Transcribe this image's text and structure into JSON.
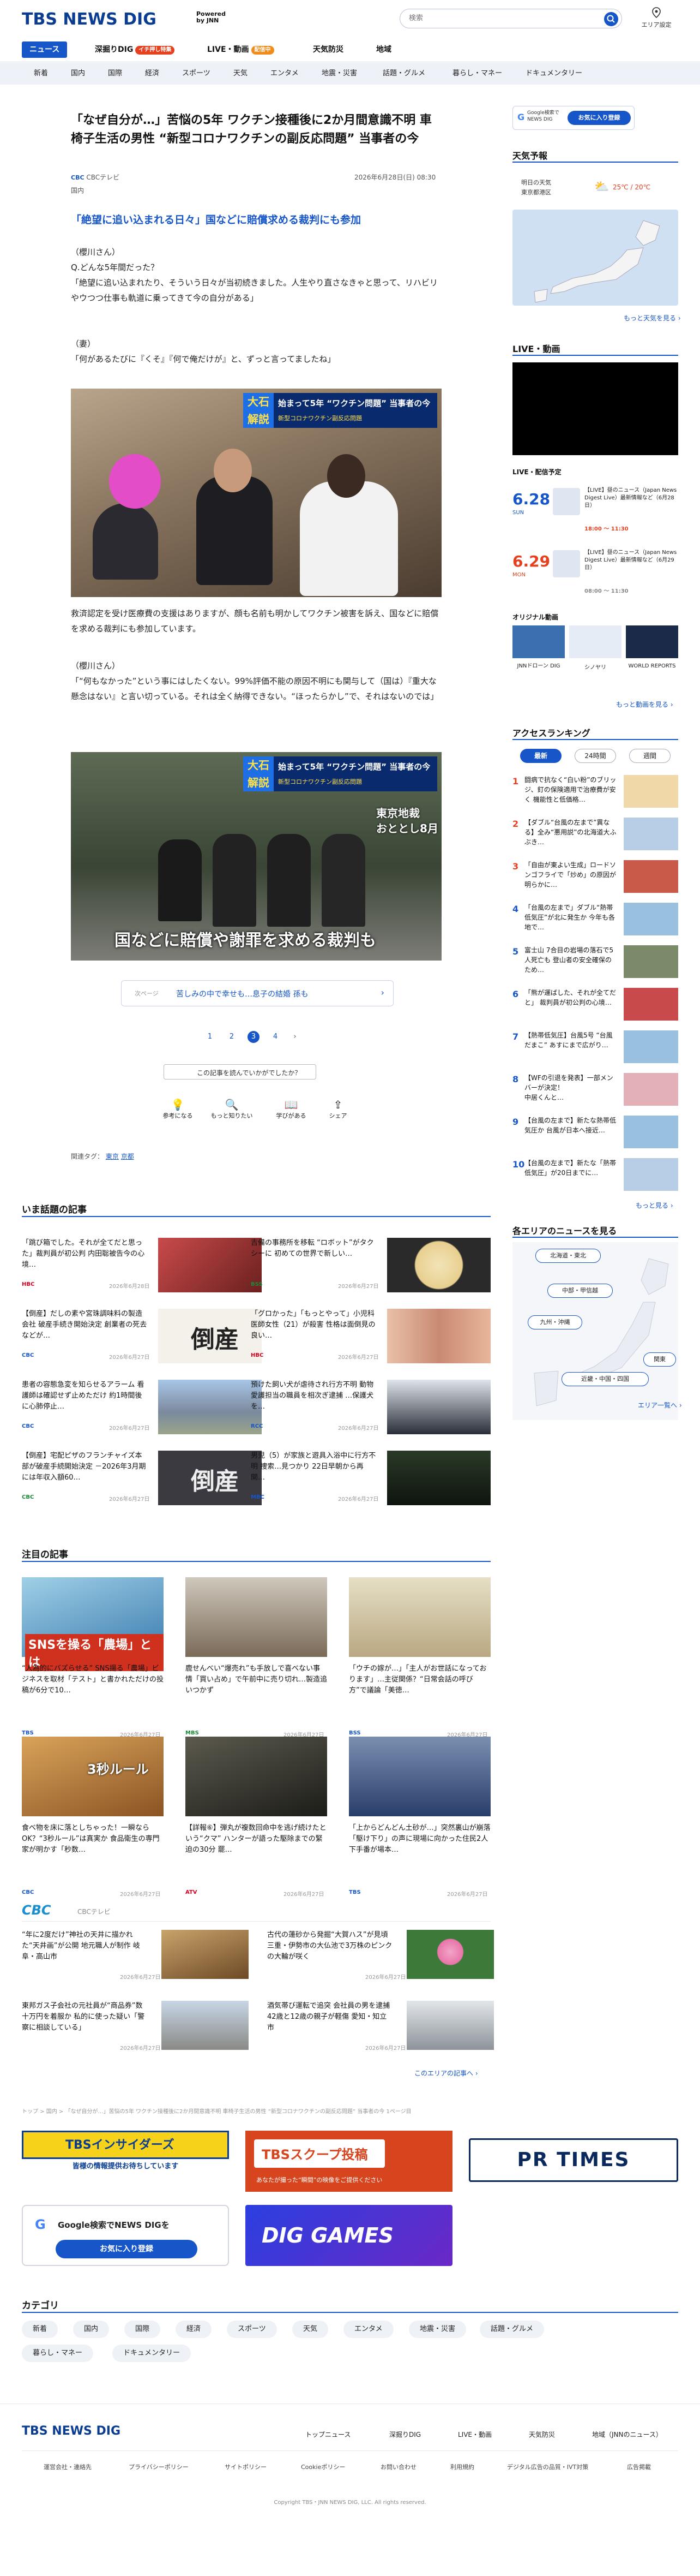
{
  "header": {
    "logo": "TBS NEWS DIG",
    "powered_line1": "Powered",
    "powered_line2": "by JNN",
    "search_placeholder": "検索",
    "area_label": "エリア設定"
  },
  "nav1": [
    {
      "label": "ニュース",
      "badge": ""
    },
    {
      "label": "深掘りDIG",
      "badge": "イチ押し特集"
    },
    {
      "label": "LIVE・動画",
      "badge": "配信中"
    },
    {
      "label": "天気防災",
      "badge": ""
    },
    {
      "label": "地域",
      "badge": ""
    }
  ],
  "nav2": [
    "新着",
    "国内",
    "国際",
    "経済",
    "スポーツ",
    "天気",
    "エンタメ",
    "地震・災害",
    "話題・グルメ",
    "暮らし・マネー",
    "ドキュメンタリー"
  ],
  "article": {
    "title": "「なぜ自分が…」苦悩の5年 ワクチン接種後に2か月間意識不明 車椅子生活の男性 “新型コロナワクチンの副反応問題” 当事者の今",
    "source": "CBCテレビ",
    "category": "国内",
    "datetime": "2026年6月28日(日) 08:30",
    "subhead": "「絶望に追い込まれる日々」国などに賠償求める裁判にも参加",
    "p1": "（櫻川さん）\nQ.どんな5年間だった？\n「絶望に追い込まれたり、そういう日々が当初続きました。人生やり直さなきゃと思って、リハビリやウつつ仕事も軌道に乗ってきて今の自分がある」",
    "p2": "（妻）\n「何があるたびに『くそ』『何で俺だけが』と、ずっと言ってましたね」",
    "photo1_caption": "始まって5年 “ワクチン問題” 当事者の今",
    "photo1_sub": "新型コロナワクチン副反応問題",
    "p3": "救済認定を受け医療費の支援はありますが、顔も名前も明かしてワクチン被害を訴え、国などに賠償を求める裁判にも参加しています。",
    "p4": "（櫻川さん）\n「“何もなかった”という事にはしたくない。99%評価不能の原因不明にも関与して（国は）『重大な懸念はない』と言い切っている。それは全く納得できない。“ほったらかし”で、それはないのでは」",
    "photo2_caption": "国などに賠償や謝罪を求める裁判も",
    "photo2_tag": "東京地裁",
    "photo2_tag2": "おととし8月",
    "next_label": "次ページ",
    "next_text": "苦しみの中で幸せも…息子の結婚 孫も",
    "pages": [
      "1",
      "2",
      "3",
      "4"
    ],
    "feedback_label": "この記事を読んでいかがでしたか？",
    "reactions": [
      "参考になる",
      "もっと知りたい",
      "学びがある",
      "シェア"
    ],
    "related_tags_label": "関連タグ：",
    "related_tags": [
      "東京",
      "京都"
    ]
  },
  "trending": {
    "title": "いま話題の記事",
    "items": [
      {
        "text": "「跳び箱でした。それが全てだと思った」裁判員が初公判 内田聡被告今の心境…",
        "source": "HBC",
        "date": "2026年6月28日"
      },
      {
        "text": "吉備の事務所を移転 “ロボット”がタクシーに 初めての世界で新しい…",
        "source": "BSS",
        "date": "2026年6月27日"
      },
      {
        "text": "【倒産】だしの素や宮珠調味料の製造会社 破産手続き開始決定 創業者の死去などが…",
        "source": "CBC",
        "date": "2026年6月27日"
      },
      {
        "text": "「グロかった」「もっとやって」小児科医師女性（21）が殺害 性格は面倒見の良い…",
        "source": "HBC",
        "date": "2026年6月27日"
      },
      {
        "text": "患者の容態急変を知らせるアラーム 看護師は確認せず止めただけ 約1時間後に心肺停止…",
        "source": "CBC",
        "date": "2026年6月27日"
      },
      {
        "text": "預けた飼い犬が虐待され行方不明 動物愛護担当の職員を相次ぎ逮捕 …保護犬を…",
        "source": "RCC",
        "date": "2026年6月27日"
      },
      {
        "text": "【倒産】宅配ピザのフランチャイズ本部が破産手続開始決定 －2026年3月期には年収入額60…",
        "source": "CBC",
        "date": "2026年6月27日"
      },
      {
        "text": "男児（5）が家族と遊具入浴中に行方不明 捜索…見つかり 22日早朝から再開…",
        "source": "MBC",
        "date": "2026年6月27日"
      }
    ]
  },
  "featured": {
    "title": "注目の記事",
    "items": [
      {
        "text": "“人為的にバズらせる” SNS揚る「農場」ビジネスを取材「テスト」と書かれただけの投稿が6分で10…",
        "source": "TBS",
        "date": "2026年6月27日",
        "img_label": "SNSを操る「農場」とは"
      },
      {
        "text": "鹿せんべい“爆売れ”も手放しで喜べない事情「買い占め」で午前中に売り切れ…製造追いつかず",
        "source": "MBS",
        "date": "2026年6月27日",
        "img_label": ""
      },
      {
        "text": "「ウチの嫁が…」「主人がお世話になっております」…主従関係？“日常会話の呼び方”で議論「美徳…",
        "source": "BSS",
        "date": "2026年6月27日",
        "img_label": ""
      },
      {
        "text": "食べ物を床に落としちゃった！一瞬ならOK？“3秒ルール”は真実か 食品衛生の専門家が明かす「秒数…",
        "source": "CBC",
        "date": "2026年6月27日",
        "img_label": "3秒ルール"
      },
      {
        "text": "【詳報⑥】弾丸が複数回命中を逃げ続けたという“クマ” ハンターが語った駆除までの緊迫の30分 罷…",
        "source": "ATV",
        "date": "2026年6月27日",
        "img_label": ""
      },
      {
        "text": "「上からどんどん土砂が…」突然裏山が崩落「駆け下り」の声に現場に向かった住民2人 下手番が場本…",
        "source": "TBS",
        "date": "2026年6月27日",
        "img_label": ""
      }
    ]
  },
  "cbc": {
    "logo": "CBC",
    "label": "CBCテレビ",
    "items": [
      {
        "text": "“年に2度だけ”神社の天井に描かれた“天井画”が公開 地元職人が制作 岐阜・高山市",
        "date": "2026年6月27日"
      },
      {
        "text": "古代の蓮砂から発掘“大賀ハス”が見頃 三重・伊勢市の大仏池で3万株のピンクの大輪が咲く",
        "date": "2026年6月27日"
      },
      {
        "text": "東邦ガス子会社の元社員が“商品券”数十万円を着服か 私的に使った疑い「警察に相談している」",
        "date": "2026年6月27日"
      },
      {
        "text": "酒気帯び運転で追突 会社員の男を逮捕 42歳と12歳の親子が軽傷 愛知・知立市",
        "date": "2026年6月27日"
      }
    ],
    "more": "このエリアの記事へ ›"
  },
  "breadcrumb": "トップ > 国内 > 「なぜ自分が…」苦悩の5年 ワクチン接種後に2か月間意識不明 車椅子生活の男性 “新型コロナワクチンの副反応問題” 当事者の今 1ページ目",
  "banners": {
    "insiders": "TBSインサイダーズ",
    "insiders_sub": "皆様の情報提供お待ちしています",
    "scoop": "TBSスクープ投稿",
    "scoop_sub": "あなたが撮った“瞬間”の映像をご提供ください",
    "prtimes": "PR TIMES",
    "google_line1": "Google検索でNEWS DIGを",
    "google_btn": "お気に入り登録",
    "games": "DIG GAMES"
  },
  "categories": {
    "title": "カテゴリ",
    "items": [
      "新着",
      "国内",
      "国際",
      "経済",
      "スポーツ",
      "天気",
      "エンタメ",
      "地震・災害",
      "話題・グルメ",
      "暮らし・マネー",
      "ドキュメンタリー"
    ]
  },
  "footer": {
    "logo": "TBS NEWS DIG",
    "links1": [
      "トップニュース",
      "深掘りDIG",
      "LIVE・動画",
      "天気防災",
      "地域（JNNのニュース）"
    ],
    "links2": [
      "運営会社・連絡先",
      "プライバシーポリシー",
      "サイトポリシー",
      "Cookieポリシー",
      "お問い合わせ",
      "利用規約",
      "デジタル広告の品質・IVT対策",
      "広告掲載"
    ],
    "copyright": "Copyright TBS・JNN NEWS DIG, LLC. All rights reserved."
  },
  "sidebar": {
    "google_btn_label": "Google検索で NEWS DIG",
    "google_add": "お気に入り登録",
    "weather_title": "天気予報",
    "weather_day": "明日の天気",
    "weather_city": "東京都港区",
    "weather_temp": "25℃ / 20℃",
    "weather_more": "もっと天気を見る ›",
    "live_title": "LIVE・動画",
    "live_schedule": "LIVE・配信予定",
    "live_items": [
      {
        "date": "6.28",
        "dow": "SUN",
        "text": "【LIVE】昼のニュース（Japan News Digest Live）最新情報など（6月28日）",
        "time": "18:00 ～ 11:30"
      },
      {
        "date": "6.29",
        "dow": "MON",
        "text": "【LIVE】昼のニュース（Japan News Digest Live）最新情報など（6月29日）",
        "time": "08:00 ～ 11:30"
      }
    ],
    "original_title": "オリジナル動画",
    "originals": [
      "JNNドローン DIG",
      "シノヤリ",
      "WORLD REPORTS"
    ],
    "live_more": "もっと動画を見る ›",
    "ranking_title": "アクセスランキング",
    "ranking_tabs": [
      "最新",
      "24時間",
      "週間"
    ],
    "ranking": [
      "闘病で抗なく“白い粉”のブリッジ、釘の保険適用で治療費が安く 機能性と低価格…",
      "【ダブル“台風の左まで”異なる】全み“悪用説”の北海道大ふぶき…",
      "「自由が東よい生成」ロードソンゴフライで「炒め」の原因が明らかに…",
      "「台風の左まで」ダブル“熱帯低気圧”が北に発生か 今年も各地で…",
      "富士山 7合目の岩場の落石で5人死亡も 登山者の安全確保のため…",
      "「熊が運ばした、それが全てだと」 裁判員が初公判の心境…",
      "【熱帯低気圧】台風5号 “台風だまこ” あすにまで広がり…",
      "【WFの引退を発表】一部メンバーが決定！\n 中居くんと…",
      "【台風の左まで】新たな熱帯低気圧か 台風が日本へ接近…",
      "【台風の左まで】新たな「熱帯低気圧」が20日までに…"
    ],
    "ranking_more": "もっと見る ›",
    "area_title": "各エリアのニュースを見る",
    "areas": [
      "北海道・東北",
      "中部・甲信越",
      "九州・沖縄",
      "関東",
      "近畿・中国・四国"
    ],
    "area_more": "エリア一覧へ ›"
  },
  "colors": {
    "primary": "#1656c8",
    "navy": "#0a3d91",
    "badge_red": "#e6401f",
    "badge_orange": "#f18b1a"
  }
}
